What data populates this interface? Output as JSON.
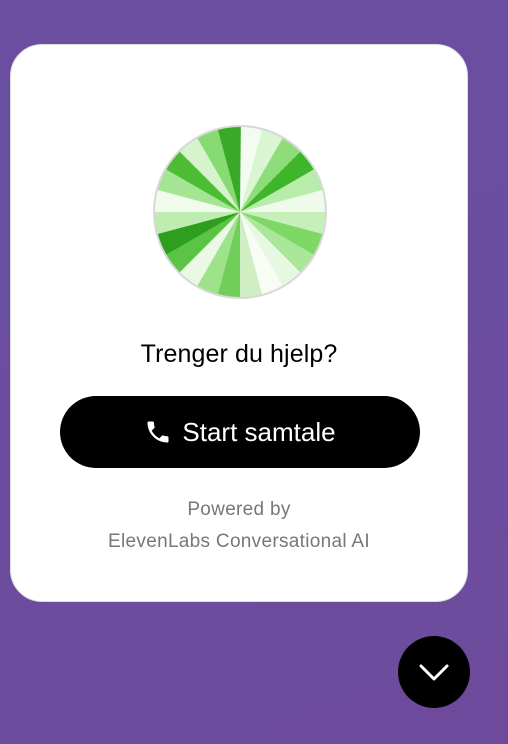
{
  "widget": {
    "prompt": "Trenger du hjelp?",
    "start_button_label": "Start samtale",
    "powered_by_line1": "Powered by",
    "powered_by_line2": "ElevenLabs Conversational AI",
    "phone_icon": "phone-icon",
    "orb_icon": "voice-orb",
    "collapse_icon": "chevron-down-icon"
  },
  "colors": {
    "background": "#6b4d9f",
    "card": "#ffffff",
    "button": "#000000",
    "orb_green": "#4fc83a"
  }
}
